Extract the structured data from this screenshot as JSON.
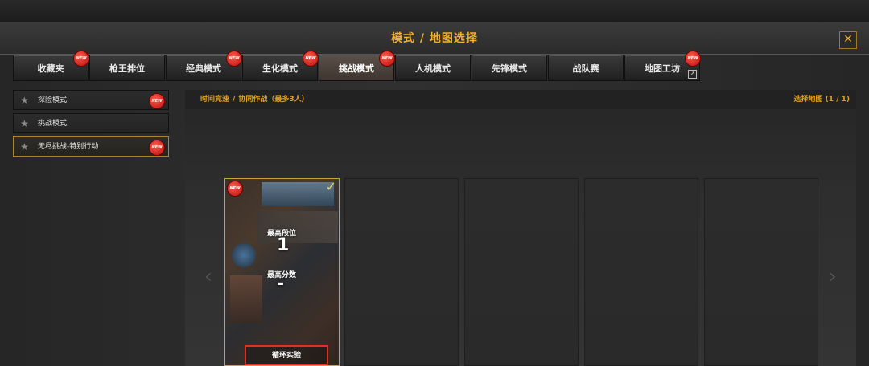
{
  "window": {
    "title": "模式 / 地图选择",
    "close_label": "✕"
  },
  "tabs": [
    {
      "label": "收藏夹",
      "badge": "NEW"
    },
    {
      "label": "枪王排位",
      "badge": ""
    },
    {
      "label": "经典模式",
      "badge": "NEW"
    },
    {
      "label": "生化模式",
      "badge": "NEW"
    },
    {
      "label": "挑战模式",
      "badge": "NEW",
      "active": true
    },
    {
      "label": "人机模式",
      "badge": ""
    },
    {
      "label": "先锋模式",
      "badge": ""
    },
    {
      "label": "战队赛",
      "badge": ""
    },
    {
      "label": "地图工坊",
      "badge": "NEW",
      "external_icon": "external-link-icon"
    }
  ],
  "modes": [
    {
      "label": "探险模式",
      "badge": "NEW",
      "icon": "star-icon"
    },
    {
      "label": "挑战模式",
      "badge": "",
      "icon": "star-icon"
    },
    {
      "label": "无尽挑战-特别行动",
      "badge": "NEW",
      "icon": "star-icon",
      "selected": true
    }
  ],
  "breadcrumb": {
    "part1": "时间竞速",
    "separator": "/",
    "part2": "协同作战（最多3人）"
  },
  "map_count": "选择地图 (1 / 1)",
  "nav": {
    "prev_icon": "chevron-left-icon",
    "next_icon": "chevron-right-icon"
  },
  "map_card": {
    "badge": "NEW",
    "check_icon": "checkmark-icon",
    "rank_label": "最高段位",
    "rank_value": "1",
    "score_label": "最高分数",
    "score_value": "-",
    "name": "循环实验"
  },
  "colors": {
    "accent": "#f0b030",
    "badge_red": "#d02020",
    "highlight_border": "#e03020"
  }
}
